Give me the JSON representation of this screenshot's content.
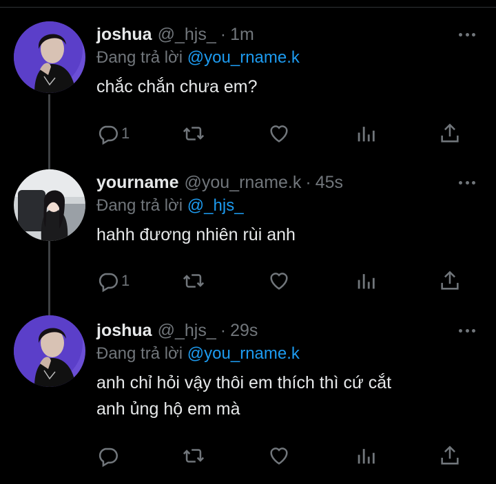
{
  "tweets": [
    {
      "name": "joshua",
      "handle": "@_hjs_",
      "separator": "·",
      "time": "1m",
      "reply_prefix": "Đang trả lời",
      "reply_to": "@you_rname.k",
      "text_lines": [
        "chắc chắn chưa em?"
      ],
      "reply_count": "1",
      "avatar": "joshua-avatar"
    },
    {
      "name": "yourname",
      "handle": "@you_rname.k",
      "separator": "·",
      "time": "45s",
      "reply_prefix": "Đang trả lời",
      "reply_to": "@_hjs_",
      "text_lines": [
        "hahh đương nhiên rùi anh"
      ],
      "reply_count": "1",
      "avatar": "yourname-avatar"
    },
    {
      "name": "joshua",
      "handle": "@_hjs_",
      "separator": "·",
      "time": "29s",
      "reply_prefix": "Đang trả lời",
      "reply_to": "@you_rname.k",
      "text_lines": [
        "anh chỉ hỏi vậy thôi em thích thì cứ cắt",
        "anh ủng hộ em mà"
      ],
      "reply_count": "",
      "avatar": "joshua-avatar"
    }
  ],
  "icons": {
    "reply": "reply-icon",
    "retweet": "retweet-icon",
    "like": "heart-icon",
    "views": "views-icon",
    "share": "share-icon",
    "more": "more-icon"
  },
  "colors": {
    "background": "#000000",
    "text": "#e7e9ea",
    "muted": "#71767b",
    "mention": "#1d9bf0",
    "thread_line": "#3e4144"
  }
}
